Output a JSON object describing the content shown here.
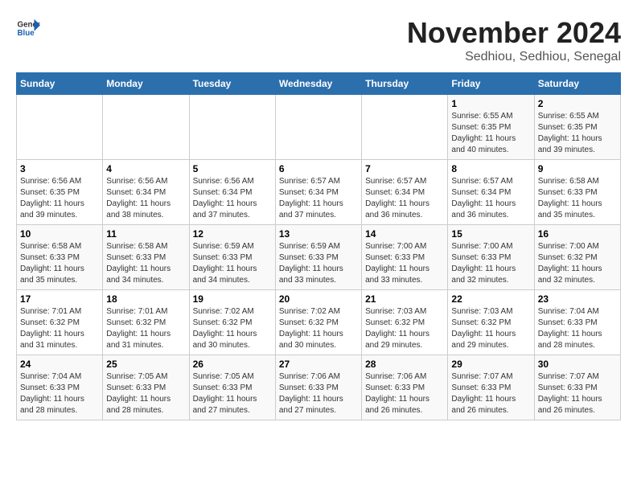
{
  "logo": {
    "text_general": "General",
    "text_blue": "Blue"
  },
  "title": "November 2024",
  "subtitle": "Sedhiou, Sedhiou, Senegal",
  "weekdays": [
    "Sunday",
    "Monday",
    "Tuesday",
    "Wednesday",
    "Thursday",
    "Friday",
    "Saturday"
  ],
  "weeks": [
    [
      {
        "day": "",
        "info": ""
      },
      {
        "day": "",
        "info": ""
      },
      {
        "day": "",
        "info": ""
      },
      {
        "day": "",
        "info": ""
      },
      {
        "day": "",
        "info": ""
      },
      {
        "day": "1",
        "info": "Sunrise: 6:55 AM\nSunset: 6:35 PM\nDaylight: 11 hours and 40 minutes."
      },
      {
        "day": "2",
        "info": "Sunrise: 6:55 AM\nSunset: 6:35 PM\nDaylight: 11 hours and 39 minutes."
      }
    ],
    [
      {
        "day": "3",
        "info": "Sunrise: 6:56 AM\nSunset: 6:35 PM\nDaylight: 11 hours and 39 minutes."
      },
      {
        "day": "4",
        "info": "Sunrise: 6:56 AM\nSunset: 6:34 PM\nDaylight: 11 hours and 38 minutes."
      },
      {
        "day": "5",
        "info": "Sunrise: 6:56 AM\nSunset: 6:34 PM\nDaylight: 11 hours and 37 minutes."
      },
      {
        "day": "6",
        "info": "Sunrise: 6:57 AM\nSunset: 6:34 PM\nDaylight: 11 hours and 37 minutes."
      },
      {
        "day": "7",
        "info": "Sunrise: 6:57 AM\nSunset: 6:34 PM\nDaylight: 11 hours and 36 minutes."
      },
      {
        "day": "8",
        "info": "Sunrise: 6:57 AM\nSunset: 6:34 PM\nDaylight: 11 hours and 36 minutes."
      },
      {
        "day": "9",
        "info": "Sunrise: 6:58 AM\nSunset: 6:33 PM\nDaylight: 11 hours and 35 minutes."
      }
    ],
    [
      {
        "day": "10",
        "info": "Sunrise: 6:58 AM\nSunset: 6:33 PM\nDaylight: 11 hours and 35 minutes."
      },
      {
        "day": "11",
        "info": "Sunrise: 6:58 AM\nSunset: 6:33 PM\nDaylight: 11 hours and 34 minutes."
      },
      {
        "day": "12",
        "info": "Sunrise: 6:59 AM\nSunset: 6:33 PM\nDaylight: 11 hours and 34 minutes."
      },
      {
        "day": "13",
        "info": "Sunrise: 6:59 AM\nSunset: 6:33 PM\nDaylight: 11 hours and 33 minutes."
      },
      {
        "day": "14",
        "info": "Sunrise: 7:00 AM\nSunset: 6:33 PM\nDaylight: 11 hours and 33 minutes."
      },
      {
        "day": "15",
        "info": "Sunrise: 7:00 AM\nSunset: 6:33 PM\nDaylight: 11 hours and 32 minutes."
      },
      {
        "day": "16",
        "info": "Sunrise: 7:00 AM\nSunset: 6:32 PM\nDaylight: 11 hours and 32 minutes."
      }
    ],
    [
      {
        "day": "17",
        "info": "Sunrise: 7:01 AM\nSunset: 6:32 PM\nDaylight: 11 hours and 31 minutes."
      },
      {
        "day": "18",
        "info": "Sunrise: 7:01 AM\nSunset: 6:32 PM\nDaylight: 11 hours and 31 minutes."
      },
      {
        "day": "19",
        "info": "Sunrise: 7:02 AM\nSunset: 6:32 PM\nDaylight: 11 hours and 30 minutes."
      },
      {
        "day": "20",
        "info": "Sunrise: 7:02 AM\nSunset: 6:32 PM\nDaylight: 11 hours and 30 minutes."
      },
      {
        "day": "21",
        "info": "Sunrise: 7:03 AM\nSunset: 6:32 PM\nDaylight: 11 hours and 29 minutes."
      },
      {
        "day": "22",
        "info": "Sunrise: 7:03 AM\nSunset: 6:32 PM\nDaylight: 11 hours and 29 minutes."
      },
      {
        "day": "23",
        "info": "Sunrise: 7:04 AM\nSunset: 6:33 PM\nDaylight: 11 hours and 28 minutes."
      }
    ],
    [
      {
        "day": "24",
        "info": "Sunrise: 7:04 AM\nSunset: 6:33 PM\nDaylight: 11 hours and 28 minutes."
      },
      {
        "day": "25",
        "info": "Sunrise: 7:05 AM\nSunset: 6:33 PM\nDaylight: 11 hours and 28 minutes."
      },
      {
        "day": "26",
        "info": "Sunrise: 7:05 AM\nSunset: 6:33 PM\nDaylight: 11 hours and 27 minutes."
      },
      {
        "day": "27",
        "info": "Sunrise: 7:06 AM\nSunset: 6:33 PM\nDaylight: 11 hours and 27 minutes."
      },
      {
        "day": "28",
        "info": "Sunrise: 7:06 AM\nSunset: 6:33 PM\nDaylight: 11 hours and 26 minutes."
      },
      {
        "day": "29",
        "info": "Sunrise: 7:07 AM\nSunset: 6:33 PM\nDaylight: 11 hours and 26 minutes."
      },
      {
        "day": "30",
        "info": "Sunrise: 7:07 AM\nSunset: 6:33 PM\nDaylight: 11 hours and 26 minutes."
      }
    ]
  ]
}
